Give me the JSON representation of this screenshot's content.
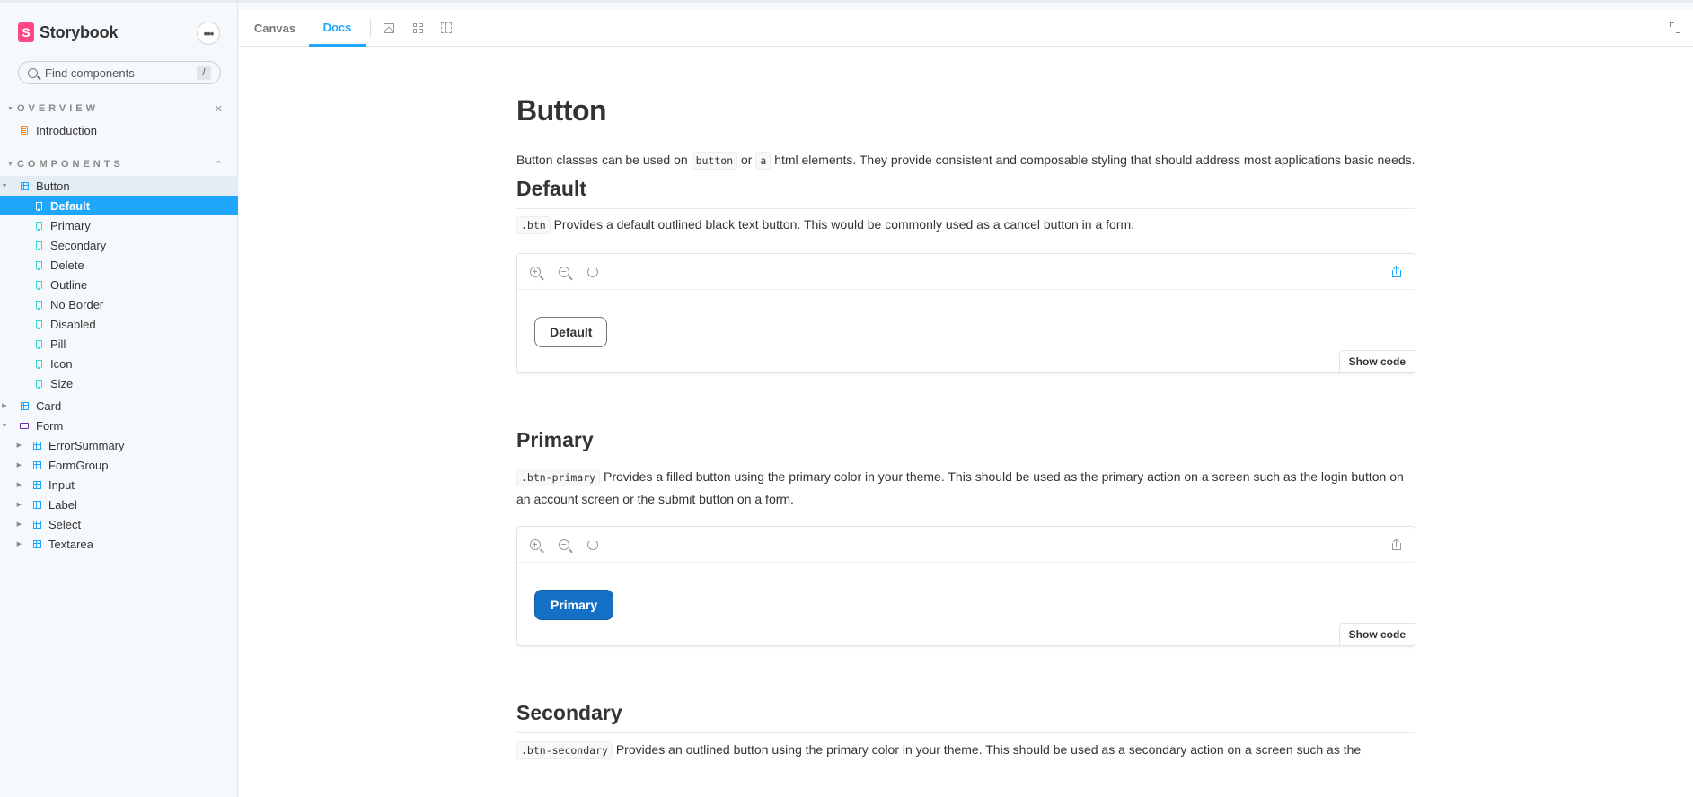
{
  "sidebar": {
    "brand": "Storybook",
    "logo_letter": "S",
    "menu_label": "•••",
    "search": {
      "placeholder": "Find components",
      "shortcut": "/"
    },
    "sections": [
      {
        "title": "OVERVIEW",
        "control": "✕"
      },
      {
        "title": "COMPONENTS",
        "control": "⌃"
      }
    ],
    "overview_items": [
      {
        "label": "Introduction",
        "icon": "document-icon"
      }
    ],
    "button_group": {
      "label": "Button",
      "stories": [
        "Default",
        "Primary",
        "Secondary",
        "Delete",
        "Outline",
        "No Border",
        "Disabled",
        "Pill",
        "Icon",
        "Size"
      ],
      "selected": "Default"
    },
    "card": {
      "label": "Card"
    },
    "form": {
      "label": "Form",
      "children": [
        "ErrorSummary",
        "FormGroup",
        "Input",
        "Label",
        "Select",
        "Textarea"
      ]
    }
  },
  "tabs": [
    {
      "label": "Canvas",
      "active": false
    },
    {
      "label": "Docs",
      "active": true
    }
  ],
  "toolbar_icons": [
    "image-icon",
    "grid-icon",
    "outline-icon",
    "fullscreen-icon"
  ],
  "docs": {
    "title": "Button",
    "intro": {
      "prefix": "Button classes can be used on",
      "code1": "button",
      "mid": "or",
      "code2": "a",
      "suffix": "html elements. They provide consistent and composable styling that should address most applications basic needs."
    },
    "sections": [
      {
        "heading": "Default",
        "code": ".btn",
        "text": "Provides a default outlined black text button. This would be commonly used as a cancel button in a form.",
        "button_label": "Default",
        "show_code": "Show code"
      },
      {
        "heading": "Primary",
        "code": ".btn-primary",
        "text": "Provides a filled button using the primary color in your theme. This should be used as the primary action on a screen such as the login button on an account screen or the submit button on a form.",
        "button_label": "Primary",
        "show_code": "Show code"
      },
      {
        "heading": "Secondary",
        "code": ".btn-secondary",
        "text": "Provides an outlined button using the primary color in your theme. This should be used as a secondary action on a screen such as the"
      }
    ]
  },
  "colors": {
    "accent": "#1ea7fd",
    "brand": "#ff4785",
    "primary_button": "#1470c4"
  }
}
